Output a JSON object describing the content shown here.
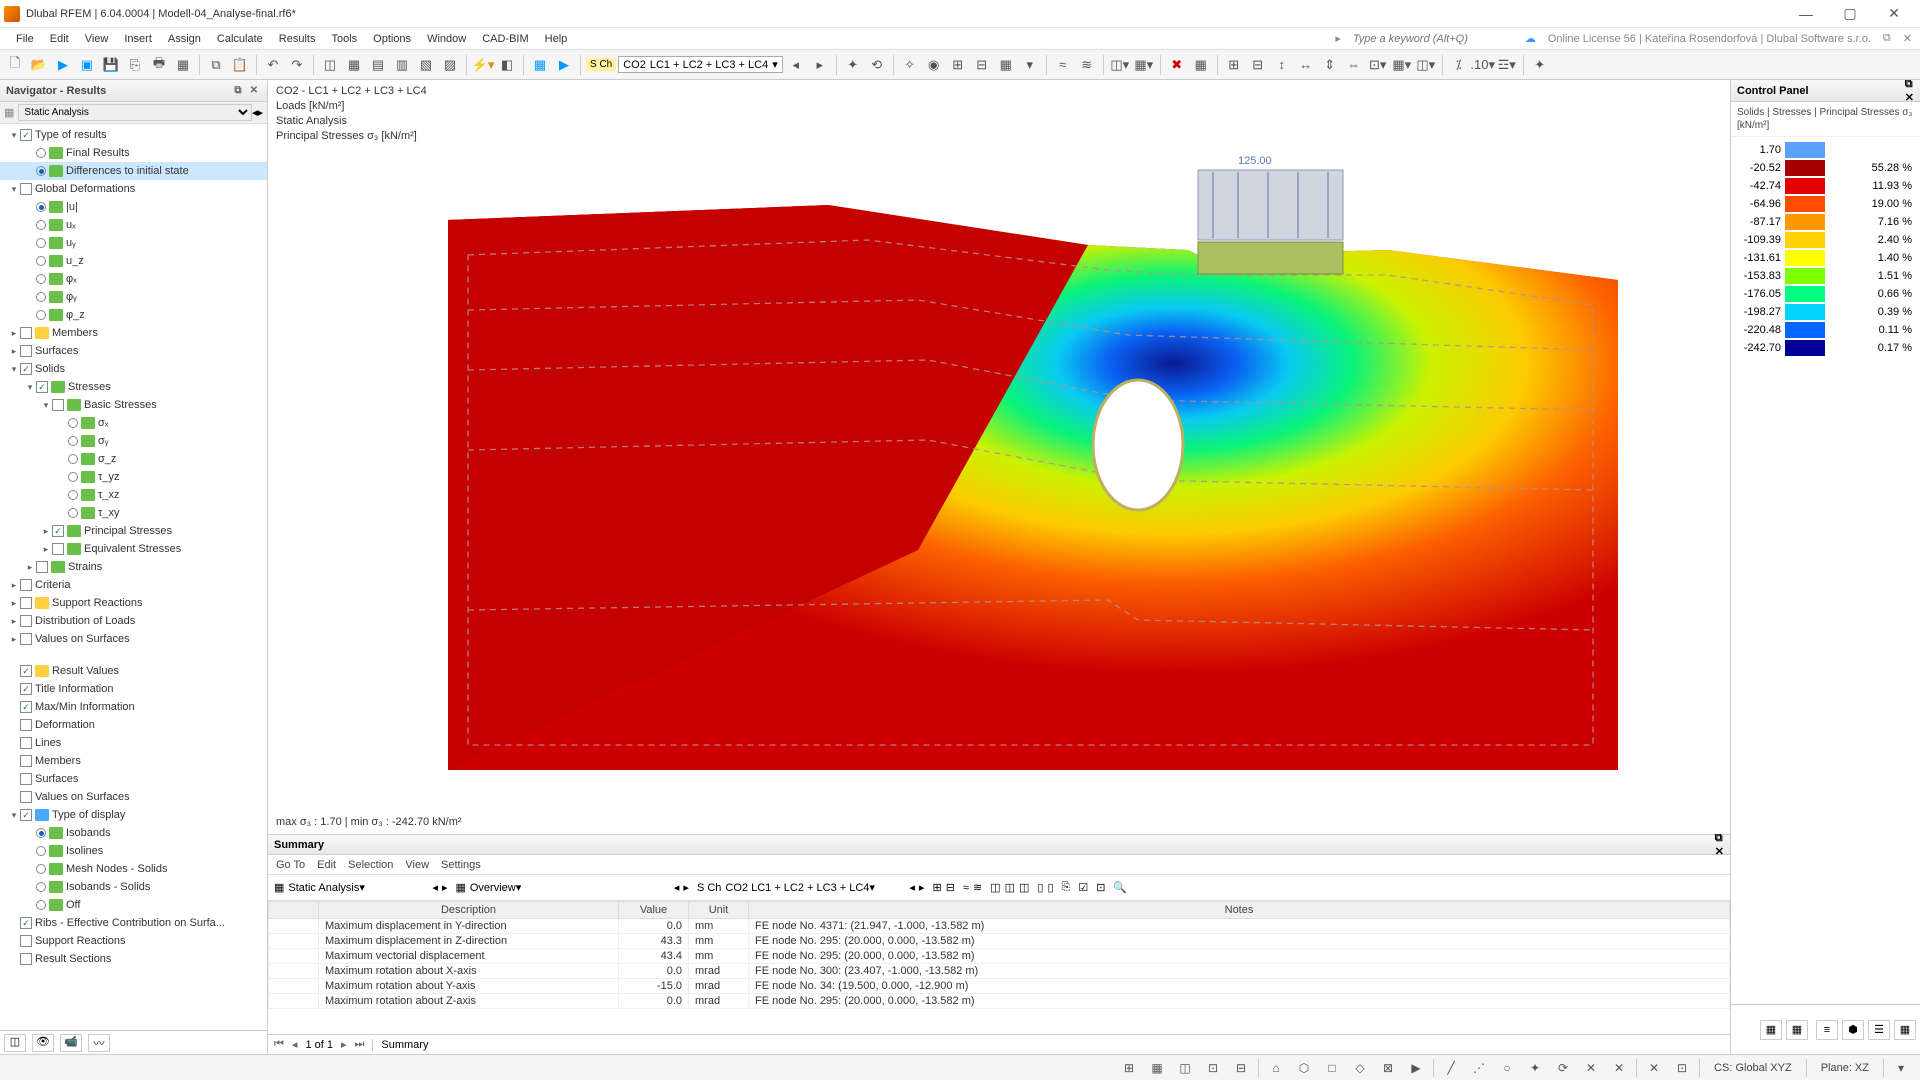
{
  "window": {
    "title": "Dlubal RFEM | 6.04.0004 | Modell-04_Analyse-final.rf6*"
  },
  "menu": [
    "File",
    "Edit",
    "View",
    "Insert",
    "Assign",
    "Calculate",
    "Results",
    "Tools",
    "Options",
    "Window",
    "CAD-BIM",
    "Help"
  ],
  "search_placeholder": "Type a keyword (Alt+Q)",
  "license": "Online License 56 | Kateřina Rosendorfová | Dlubal Software s.r.o.",
  "toolbar": {
    "sch": "S Ch",
    "combo_label": "CO2",
    "combo_full": "LC1 + LC2 + LC3 + LC4"
  },
  "nav": {
    "title": "Navigator - Results",
    "dropdown": "Static Analysis",
    "tree": [
      {
        "ind": 0,
        "exp": "▾",
        "chk": 1,
        "lbl": "Type of results"
      },
      {
        "ind": 1,
        "rad": 0,
        "ico": "g",
        "lbl": "Final Results"
      },
      {
        "ind": 1,
        "rad": 1,
        "ico": "g",
        "lbl": "Differences to initial state",
        "sel": 1
      },
      {
        "ind": 0,
        "exp": "▾",
        "chk": 0,
        "lbl": "Global Deformations"
      },
      {
        "ind": 1,
        "rad": 1,
        "ico": "g",
        "lbl": "|u|"
      },
      {
        "ind": 1,
        "rad": 0,
        "ico": "g",
        "lbl": "uₓ"
      },
      {
        "ind": 1,
        "rad": 0,
        "ico": "g",
        "lbl": "uᵧ"
      },
      {
        "ind": 1,
        "rad": 0,
        "ico": "g",
        "lbl": "u_z"
      },
      {
        "ind": 1,
        "rad": 0,
        "ico": "g",
        "lbl": "φₓ"
      },
      {
        "ind": 1,
        "rad": 0,
        "ico": "g",
        "lbl": "φᵧ"
      },
      {
        "ind": 1,
        "rad": 0,
        "ico": "g",
        "lbl": "φ_z"
      },
      {
        "ind": 0,
        "exp": "▸",
        "chk": 0,
        "ico": "y",
        "lbl": "Members"
      },
      {
        "ind": 0,
        "exp": "▸",
        "chk": 0,
        "lbl": "Surfaces"
      },
      {
        "ind": 0,
        "exp": "▾",
        "chk": 1,
        "lbl": "Solids"
      },
      {
        "ind": 1,
        "exp": "▾",
        "chk": 1,
        "ico": "g",
        "lbl": "Stresses"
      },
      {
        "ind": 2,
        "exp": "▾",
        "chk": 0,
        "ico": "g",
        "lbl": "Basic Stresses"
      },
      {
        "ind": 3,
        "rad": 0,
        "ico": "g",
        "lbl": "σₓ"
      },
      {
        "ind": 3,
        "rad": 0,
        "ico": "g",
        "lbl": "σᵧ"
      },
      {
        "ind": 3,
        "rad": 0,
        "ico": "g",
        "lbl": "σ_z"
      },
      {
        "ind": 3,
        "rad": 0,
        "ico": "g",
        "lbl": "τ_yz"
      },
      {
        "ind": 3,
        "rad": 0,
        "ico": "g",
        "lbl": "τ_xz"
      },
      {
        "ind": 3,
        "rad": 0,
        "ico": "g",
        "lbl": "τ_xy"
      },
      {
        "ind": 2,
        "exp": "▸",
        "chk": 1,
        "ico": "g",
        "lbl": "Principal Stresses"
      },
      {
        "ind": 2,
        "exp": "▸",
        "chk": 0,
        "ico": "g",
        "lbl": "Equivalent Stresses"
      },
      {
        "ind": 1,
        "exp": "▸",
        "chk": 0,
        "ico": "g",
        "lbl": "Strains"
      },
      {
        "ind": 0,
        "exp": "▸",
        "chk": 0,
        "lbl": "Criteria"
      },
      {
        "ind": 0,
        "exp": "▸",
        "chk": 0,
        "ico": "y",
        "lbl": "Support Reactions"
      },
      {
        "ind": 0,
        "exp": "▸",
        "chk": 0,
        "lbl": "Distribution of Loads"
      },
      {
        "ind": 0,
        "exp": "▸",
        "chk": 0,
        "lbl": "Values on Surfaces"
      }
    ],
    "tree2": [
      {
        "ind": 0,
        "chk": 1,
        "ico": "y",
        "lbl": "Result Values"
      },
      {
        "ind": 0,
        "chk": 1,
        "lbl": "Title Information"
      },
      {
        "ind": 0,
        "chk": 1,
        "lbl": "Max/Min Information"
      },
      {
        "ind": 0,
        "chk": 0,
        "lbl": "Deformation"
      },
      {
        "ind": 0,
        "chk": 0,
        "lbl": "Lines"
      },
      {
        "ind": 0,
        "chk": 0,
        "lbl": "Members"
      },
      {
        "ind": 0,
        "chk": 0,
        "lbl": "Surfaces"
      },
      {
        "ind": 0,
        "chk": 0,
        "lbl": "Values on Surfaces"
      },
      {
        "ind": 0,
        "exp": "▾",
        "chk": 1,
        "ico": "b",
        "lbl": "Type of display"
      },
      {
        "ind": 1,
        "rad": 1,
        "ico": "g",
        "lbl": "Isobands"
      },
      {
        "ind": 1,
        "rad": 0,
        "ico": "g",
        "lbl": "Isolines"
      },
      {
        "ind": 1,
        "rad": 0,
        "ico": "g",
        "lbl": "Mesh Nodes - Solids"
      },
      {
        "ind": 1,
        "rad": 0,
        "ico": "g",
        "lbl": "Isobands - Solids"
      },
      {
        "ind": 1,
        "rad": 0,
        "ico": "g",
        "lbl": "Off"
      },
      {
        "ind": 0,
        "chk": 1,
        "lbl": "Ribs - Effective Contribution on Surfa..."
      },
      {
        "ind": 0,
        "chk": 0,
        "lbl": "Support Reactions"
      },
      {
        "ind": 0,
        "chk": 0,
        "lbl": "Result Sections"
      }
    ]
  },
  "viewport": {
    "line1": "CO2 - LC1 + LC2 + LC3 + LC4",
    "line2": "Loads [kN/m²]",
    "line3": "Static Analysis",
    "line4": "Principal Stresses σ₃ [kN/m²]",
    "foot": "max σ₃ : 1.70 | min σ₃ : -242.70 kN/m²",
    "loadval": "125.00"
  },
  "summary": {
    "title": "Summary",
    "menu": [
      "Go To",
      "Edit",
      "Selection",
      "View",
      "Settings"
    ],
    "combo1": "Static Analysis",
    "combo2": "Overview",
    "sch": "S Ch",
    "co": "CO2",
    "full": "LC1 + LC2 + LC3 + LC4",
    "cols": [
      "",
      "Description",
      "Value",
      "Unit",
      "Notes"
    ],
    "rows": [
      [
        "",
        "Maximum displacement in Y-direction",
        "0.0",
        "mm",
        "FE node No. 4371: (21.947, -1.000, -13.582 m)"
      ],
      [
        "",
        "Maximum displacement in Z-direction",
        "43.3",
        "mm",
        "FE node No. 295: (20.000, 0.000, -13.582 m)"
      ],
      [
        "",
        "Maximum vectorial displacement",
        "43.4",
        "mm",
        "FE node No. 295: (20.000, 0.000, -13.582 m)"
      ],
      [
        "",
        "Maximum rotation about X-axis",
        "0.0",
        "mrad",
        "FE node No. 300: (23.407, -1.000, -13.582 m)"
      ],
      [
        "",
        "Maximum rotation about Y-axis",
        "-15.0",
        "mrad",
        "FE node No. 34: (19.500, 0.000, -12.900 m)"
      ],
      [
        "",
        "Maximum rotation about Z-axis",
        "0.0",
        "mrad",
        "FE node No. 295: (20.000, 0.000, -13.582 m)"
      ]
    ],
    "page": "1 of 1",
    "tab": "Summary"
  },
  "ctrl": {
    "title": "Control Panel",
    "subtitle": "Solids | Stresses | Principal Stresses σ₃ [kN/m²]",
    "legend": [
      {
        "v": "1.70",
        "c": "#5aa0ff",
        "p": ""
      },
      {
        "v": "-20.52",
        "c": "#a80000",
        "p": "55.28 %"
      },
      {
        "v": "-42.74",
        "c": "#e50000",
        "p": "11.93 %"
      },
      {
        "v": "-64.96",
        "c": "#ff4d00",
        "p": "19.00 %"
      },
      {
        "v": "-87.17",
        "c": "#ff9900",
        "p": "7.16 %"
      },
      {
        "v": "-109.39",
        "c": "#ffd400",
        "p": "2.40 %"
      },
      {
        "v": "-131.61",
        "c": "#ffff00",
        "p": "1.40 %"
      },
      {
        "v": "-153.83",
        "c": "#80ff00",
        "p": "1.51 %"
      },
      {
        "v": "-176.05",
        "c": "#00ff80",
        "p": "0.66 %"
      },
      {
        "v": "-198.27",
        "c": "#00d4ff",
        "p": "0.39 %"
      },
      {
        "v": "-220.48",
        "c": "#0066ff",
        "p": "0.11 %"
      },
      {
        "v": "-242.70",
        "c": "#000099",
        "p": "0.17 %"
      }
    ]
  },
  "status": {
    "cs": "CS: Global XYZ",
    "plane": "Plane: XZ"
  }
}
